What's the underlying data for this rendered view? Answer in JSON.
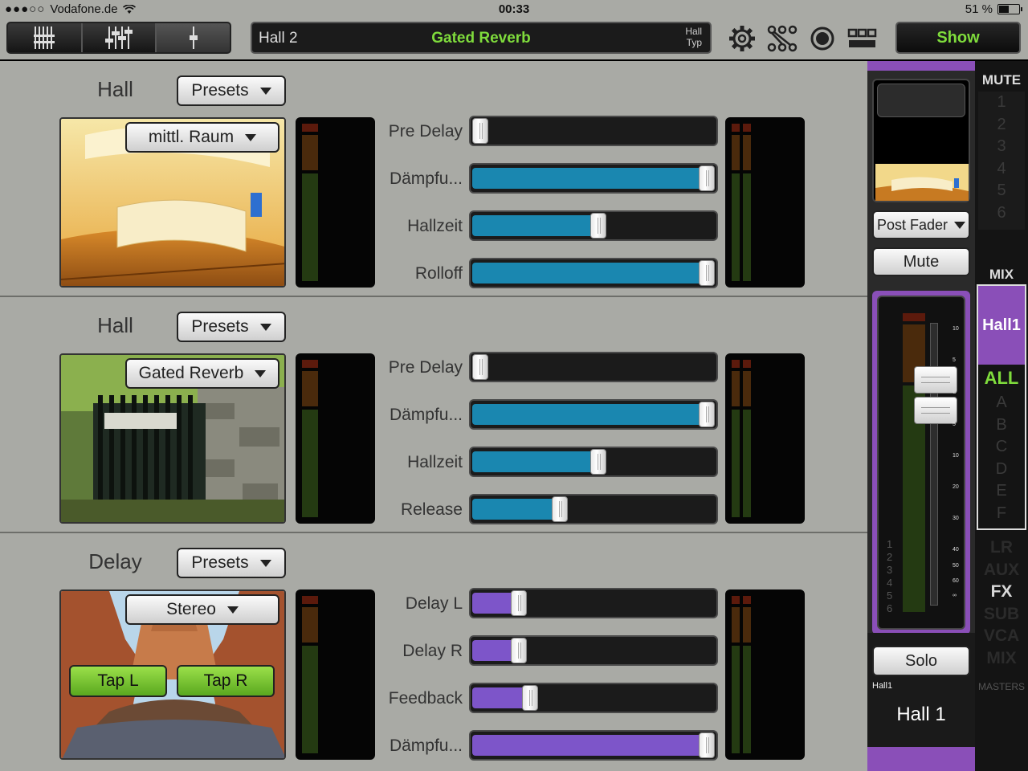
{
  "status": {
    "carrier": "Vodafone.de",
    "time": "00:33",
    "battery": "51 %"
  },
  "toolbar": {
    "channel": "Hall 2",
    "effect": "Gated Reverb",
    "typ_line1": "Hall",
    "typ_line2": "Typ",
    "show_label": "Show"
  },
  "blocks": [
    {
      "title": "Hall",
      "presets_label": "Presets",
      "preset_value": "mittl. Raum",
      "params": [
        {
          "label": "Pre Delay",
          "value": 0.0
        },
        {
          "label": "Dämpfu...",
          "value": 1.0
        },
        {
          "label": "Hallzeit",
          "value": 0.52
        },
        {
          "label": "Rolloff",
          "value": 1.0
        }
      ]
    },
    {
      "title": "Hall",
      "presets_label": "Presets",
      "preset_value": "Gated Reverb",
      "params": [
        {
          "label": "Pre Delay",
          "value": 0.0
        },
        {
          "label": "Dämpfu...",
          "value": 1.0
        },
        {
          "label": "Hallzeit",
          "value": 0.52
        },
        {
          "label": "Release",
          "value": 0.35
        }
      ]
    },
    {
      "title": "Delay",
      "presets_label": "Presets",
      "preset_value": "Stereo",
      "tap_l": "Tap L",
      "tap_r": "Tap R",
      "params": [
        {
          "label": "Delay L",
          "value": 0.17
        },
        {
          "label": "Delay R",
          "value": 0.17
        },
        {
          "label": "Feedback",
          "value": 0.22
        },
        {
          "label": "Dämpfu...",
          "value": 1.0
        }
      ]
    }
  ],
  "strip": {
    "post_fader": "Post Fader",
    "mute": "Mute",
    "solo": "Solo",
    "channel_small": "Hall1",
    "channel_big": "Hall 1",
    "scale": [
      "10",
      "5",
      "U",
      "5",
      "10",
      "20",
      "30",
      "40",
      "50",
      "60",
      "∞"
    ],
    "nums": [
      "1",
      "2",
      "3",
      "4",
      "5",
      "6"
    ]
  },
  "nav": {
    "mute_title": "MUTE",
    "mute_items": [
      "1",
      "2",
      "3",
      "4",
      "5",
      "6"
    ],
    "mix_title": "MIX",
    "selected": "Hall1",
    "all": "ALL",
    "letters": [
      "A",
      "B",
      "C",
      "D",
      "E",
      "F"
    ],
    "categories": [
      "LR",
      "AUX",
      "FX",
      "SUB",
      "VCA",
      "MIX"
    ],
    "active_category": "FX",
    "masters": "MASTERS"
  },
  "colors": {
    "accent_green": "#7fdc3c",
    "reverb_fill": "#1a87b0",
    "delay_fill": "#7d55c9",
    "purple": "#8a4fb8"
  }
}
